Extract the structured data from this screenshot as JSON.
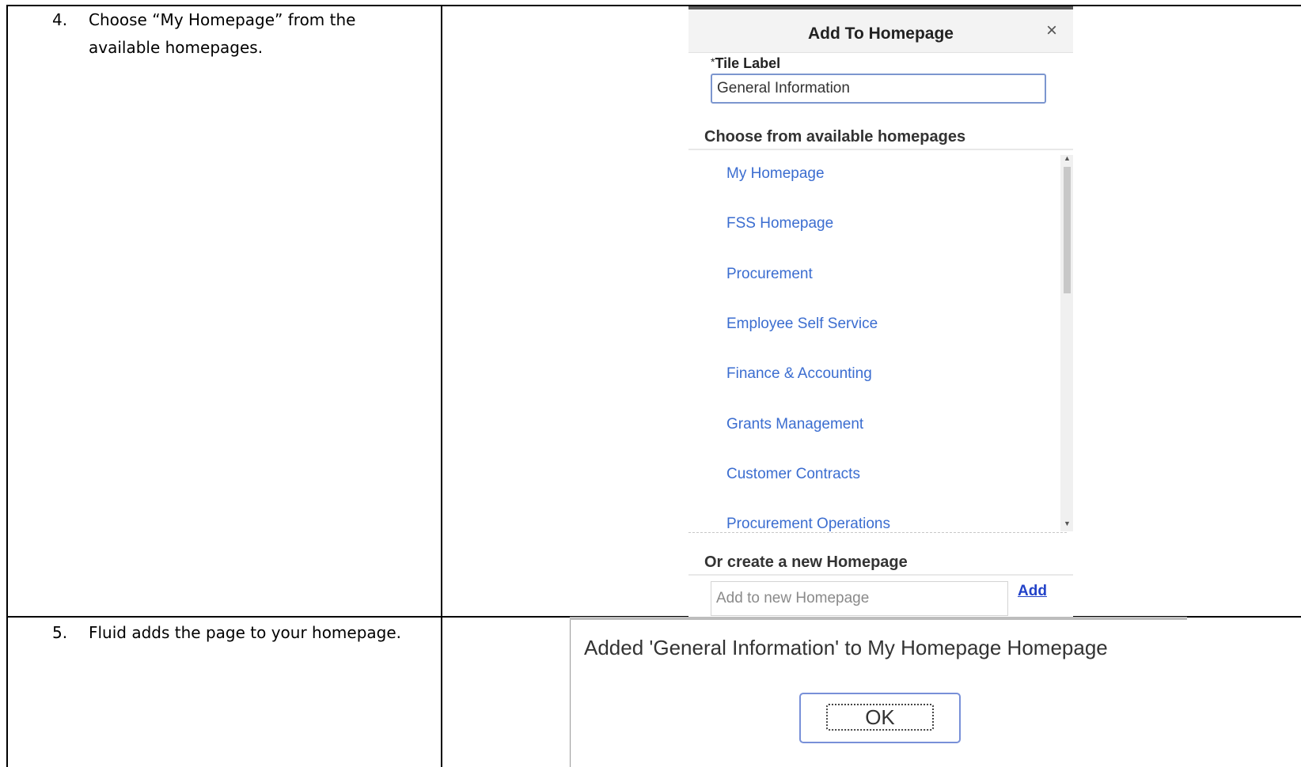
{
  "steps": [
    {
      "number": "4.",
      "text": "Choose “My Homepage” from the available homepages."
    },
    {
      "number": "5.",
      "text": "Fluid adds the page to your homepage."
    }
  ],
  "dialog": {
    "title": "Add To Homepage",
    "close_glyph": "×",
    "tile_label": "Tile Label",
    "required_marker": "*",
    "tile_value": "General Information",
    "choose_heading": "Choose from available homepages",
    "homepages": [
      "My Homepage",
      "FSS Homepage",
      "Procurement",
      "Employee Self Service",
      "Finance & Accounting",
      "Grants Management",
      "Customer Contracts",
      "Procurement Operations"
    ],
    "create_heading": "Or create a new Homepage",
    "new_placeholder": "Add to new Homepage",
    "add_link": "Add"
  },
  "confirmation": {
    "message": "Added 'General Information' to My Homepage Homepage",
    "ok_label": "OK"
  },
  "colors": {
    "link": "#3b6dd0",
    "add_link": "#2242c8",
    "input_border": "#7c96cf"
  }
}
